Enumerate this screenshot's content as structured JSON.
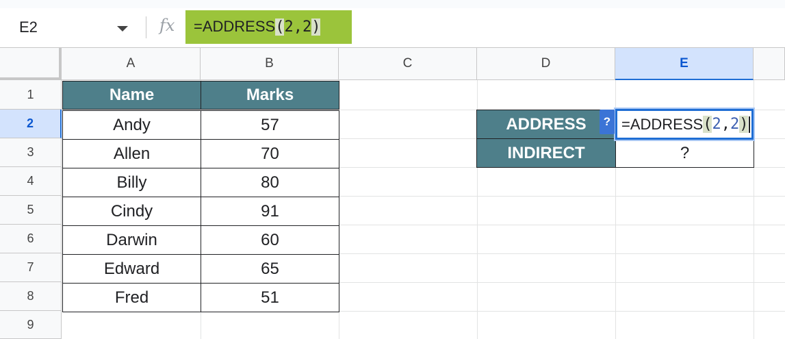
{
  "namebox": {
    "value": "E2"
  },
  "formula_bar": {
    "fx_label": "fx",
    "prefix": "=ADDRESS",
    "open_paren": "(",
    "args": "2,2",
    "close_paren": ")"
  },
  "columns": [
    "A",
    "B",
    "C",
    "D",
    "E"
  ],
  "rows": [
    "1",
    "2",
    "3",
    "4",
    "5",
    "6",
    "7",
    "8",
    "9"
  ],
  "selected": {
    "column": "E",
    "row": "2"
  },
  "table": {
    "headers": [
      "Name",
      "Marks"
    ],
    "rows": [
      [
        "Andy",
        "57"
      ],
      [
        "Allen",
        "70"
      ],
      [
        "Billy",
        "80"
      ],
      [
        "Cindy",
        "91"
      ],
      [
        "Darwin",
        "60"
      ],
      [
        "Edward",
        "65"
      ],
      [
        "Fred",
        "51"
      ]
    ]
  },
  "lookup": {
    "address_label": "ADDRESS",
    "indirect_label": "INDIRECT",
    "address_formula": {
      "prefix": "=ADDRESS",
      "open_paren": "(",
      "arg1": "2",
      "comma": ",",
      "arg2": "2",
      "close_paren": ")"
    },
    "indirect_value": "?",
    "help_badge": "?"
  },
  "colors": {
    "header_fill": "#4e7f8a",
    "formula_highlight": "#9bc43b",
    "selection_blue": "#1f6ed4"
  }
}
